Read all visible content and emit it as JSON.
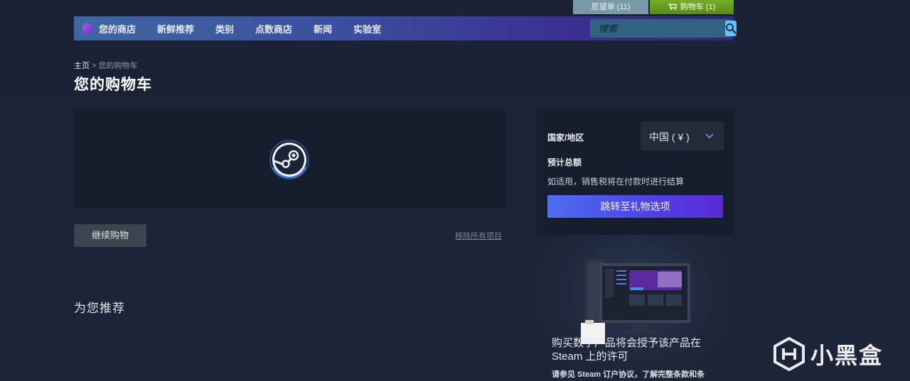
{
  "top_links": {
    "wishlist": "愿望单 (11)",
    "cart": "购物车 (1)"
  },
  "nav": {
    "items": [
      "您的商店",
      "新鲜推荐",
      "类别",
      "点数商店",
      "新闻",
      "实验室"
    ],
    "search_placeholder": "搜索"
  },
  "breadcrumb": {
    "home": "主页",
    "separator": ">",
    "current": "您的购物车"
  },
  "page_title": "您的购物车",
  "cart": {
    "continue_label": "继续购物",
    "remove_all_label": "移除所有项目"
  },
  "recommend_title": "为您推荐",
  "summary": {
    "country_label": "国家/地区",
    "country_value": "中国 ( ¥ )",
    "estimated_total_label": "预计总额",
    "tax_note": "如适用，销售税将在付款时进行结算",
    "gift_button": "跳转至礼物选项"
  },
  "license": {
    "title": "购买数字产品将会授予该产品在 Steam 上的许可",
    "subtitle": "请参见 Steam 订户协议，了解完整条款和条"
  },
  "watermark": "小黑盒",
  "colors": {
    "background": "#1b2236",
    "panel": "#161d2c",
    "cart_green": "#75b022",
    "search_blue": "#67c1f5",
    "gift_purple": "#5a2ad6"
  }
}
